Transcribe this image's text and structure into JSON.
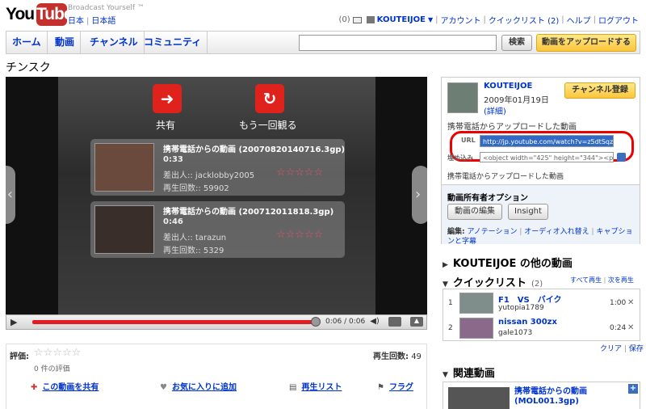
{
  "header": {
    "logo_you": "You",
    "logo_tube": "Tube",
    "tagline": "Broadcast Yourself ™",
    "locale": [
      "日本",
      "日本語"
    ],
    "inbox_count": "(0)",
    "username": "KOUTEIJOE",
    "account": "アカウント",
    "quicklist": "クイックリスト (2)",
    "help": "ヘルプ",
    "logout": "ログアウト"
  },
  "nav": {
    "items": [
      "ホーム",
      "動画",
      "チャンネル",
      "コミュニティ"
    ],
    "search_button": "検索",
    "upload_button": "動画をアップロードする"
  },
  "video": {
    "title": "チンスク",
    "share_label": "共有",
    "replay_label": "もう一回観る",
    "time": "0:06 / 0:06",
    "related": [
      {
        "title": "携帯電話からの動画 (20070820140716.3gp)",
        "duration": "0:33",
        "from": "差出人:: jacklobby2005",
        "views": "再生回数:: 59902",
        "stars": "☆☆☆☆☆"
      },
      {
        "title": "携帯電話からの動画 (200712011818.3gp)",
        "duration": "0:46",
        "from": "差出人:: tarazun",
        "views": "再生回数:: 5329",
        "stars": "☆☆☆☆☆"
      }
    ]
  },
  "rating": {
    "label": "評価:",
    "stars": "☆☆☆☆☆",
    "count": "0 件の評価",
    "views_label": "再生回数:",
    "views_value": "49"
  },
  "actions": {
    "share": "この動画を共有",
    "favorite": "お気に入りに追加",
    "playlist": "再生リスト",
    "flag": "フラグ"
  },
  "channel": {
    "name": "KOUTEIJOE",
    "date": "2009年01月19日",
    "more": "(詳細)",
    "subscribe": "チャンネル登録",
    "description": "携帯電話からアップロードした動画",
    "url_label": "URL",
    "url_value": "http://jp.youtube.com/watch?v=z5dtSqzjy",
    "embed_label": "埋め込み",
    "embed_value": "<object width=\"425\" height=\"344\"><param",
    "description2": "携帯電話からアップロードした動画"
  },
  "owner": {
    "heading": "動画所有者オプション",
    "edit_button": "動画の編集",
    "insight_button": "Insight",
    "edit_label": "編集:",
    "links": [
      "アノテーション",
      "オーディオ入れ替え",
      "キャプションと字幕"
    ]
  },
  "sections": {
    "more_from": "KOUTEIJOE の他の動画",
    "quicklist": "クイックリスト",
    "quicklist_count": "(2)",
    "play_all": "すべて再生",
    "play_next": "次を再生",
    "clear": "クリア",
    "save": "保存",
    "related": "関連動画"
  },
  "quicklist_items": [
    {
      "num": "1",
      "title": "F1　VS　バイク",
      "user": "yutopia1789",
      "duration": "1:00"
    },
    {
      "num": "2",
      "title": "nissan 300zx",
      "user": "gale1073",
      "duration": "0:24"
    }
  ],
  "related_item": {
    "title_line1": "携帯電話からの動画",
    "title_line2": "(MOL001.3gp)"
  }
}
